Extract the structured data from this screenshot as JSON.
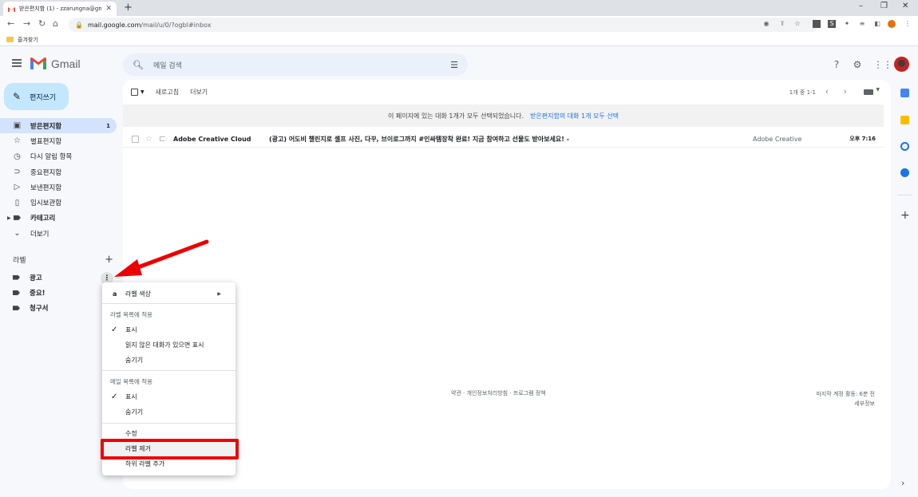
{
  "browser": {
    "tab_title": "받은편지함 (1) - zzarungna@gm",
    "url_host": "mail.google.com",
    "url_path": "/mail/u/0/?ogbl#inbox",
    "bookmark_label": "즐겨찾기"
  },
  "gmail": {
    "logo_text": "Gmail",
    "search_placeholder": "메일 검색",
    "compose_label": "편지쓰기",
    "brand_color": "#c2e7ff"
  },
  "sidebar": {
    "items": [
      {
        "label": "받은편지함",
        "icon": "inbox-icon",
        "count": "1"
      },
      {
        "label": "별표편지함",
        "icon": "star-icon"
      },
      {
        "label": "다시 알림 항목",
        "icon": "clock-icon"
      },
      {
        "label": "중요편지함",
        "icon": "important-icon"
      },
      {
        "label": "보낸편지함",
        "icon": "send-icon"
      },
      {
        "label": "임시보관함",
        "icon": "draft-icon"
      },
      {
        "label": "카테고리",
        "icon": "label-icon"
      },
      {
        "label": "더보기",
        "icon": "chevron-down-icon"
      }
    ],
    "labels_title": "라벨",
    "labels": [
      {
        "name": "광고"
      },
      {
        "name": "중요!"
      },
      {
        "name": "청구서"
      }
    ]
  },
  "toolbar": {
    "refresh": "새로고침",
    "more": "더보기",
    "pager": "1개 중 1-1"
  },
  "banner": {
    "text": "이 페이지에 있는 대화 1개가 모두 선택되었습니다.",
    "link": "받은편지함의 대화 1개 모두 선택"
  },
  "mail": {
    "sender": "Adobe Creative Cloud",
    "subject": "(광고) 어도비 챌린지로 셀프 사진, 다꾸, 브이로그까지 #인싸템장착 완료! 지금 참여하고 선물도 받아보세요! -",
    "tag": "Adobe Creative",
    "time": "오후 7:16"
  },
  "footer": {
    "links": "약관 · 개인정보처리방침 · 프로그램 정책",
    "activity": "마지막 계정 활동: 6분 전",
    "details": "세부정보"
  },
  "context_menu": {
    "label_color": "라벨 색상",
    "section1": "라벨 목록에 적용",
    "show1": "표시",
    "show_unread": "읽지 않은 대화가 있으면 표시",
    "hide1": "숨기기",
    "section2": "메일 목록에 적용",
    "show2": "표시",
    "hide2": "숨기기",
    "edit": "수정",
    "remove": "라벨 제거",
    "add_sub": "하위 라벨 추가"
  }
}
